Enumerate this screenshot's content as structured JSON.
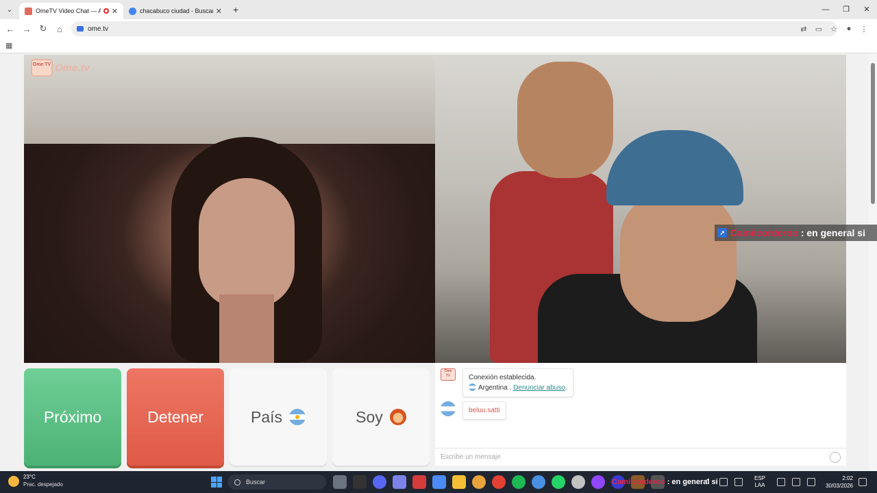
{
  "browser": {
    "tabs": [
      {
        "title": "OmeTV Video Chat — Alter",
        "active": true
      },
      {
        "title": "chacabuco ciudad - Buscar con",
        "active": false
      }
    ],
    "new_tab": "+",
    "url": "ome.tv"
  },
  "site": {
    "logo_badge": "Ome TV",
    "logo_text": "Ome.tv"
  },
  "stream_overlay": {
    "username": "Camiicorderoo",
    "message": ": en general si"
  },
  "controls": {
    "next_label": "Próximo",
    "stop_label": "Detener",
    "country_label": "País",
    "gender_label": "Soy"
  },
  "chat": {
    "system_line1": "Conexión establecida.",
    "system_country": "Argentina .",
    "report_link": "Denunciar abuso",
    "report_suffix": ".",
    "user_message": "beluu.satti",
    "input_placeholder": "Escribe un mensaje"
  },
  "taskbar": {
    "temperature": "23°C",
    "weather": "Prac. despejado",
    "search_label": "Buscar",
    "overlay_username": "Camiicorderoo",
    "overlay_message": ": en general si",
    "lang_top": "ESP",
    "lang_bottom": "LAA",
    "time": "2:02",
    "date": "30/03/2026"
  },
  "colors": {
    "next_button": "#4db276",
    "stop_button": "#de5a46",
    "overlay_username": "#e0284a",
    "report_link": "#2b8a8a"
  }
}
